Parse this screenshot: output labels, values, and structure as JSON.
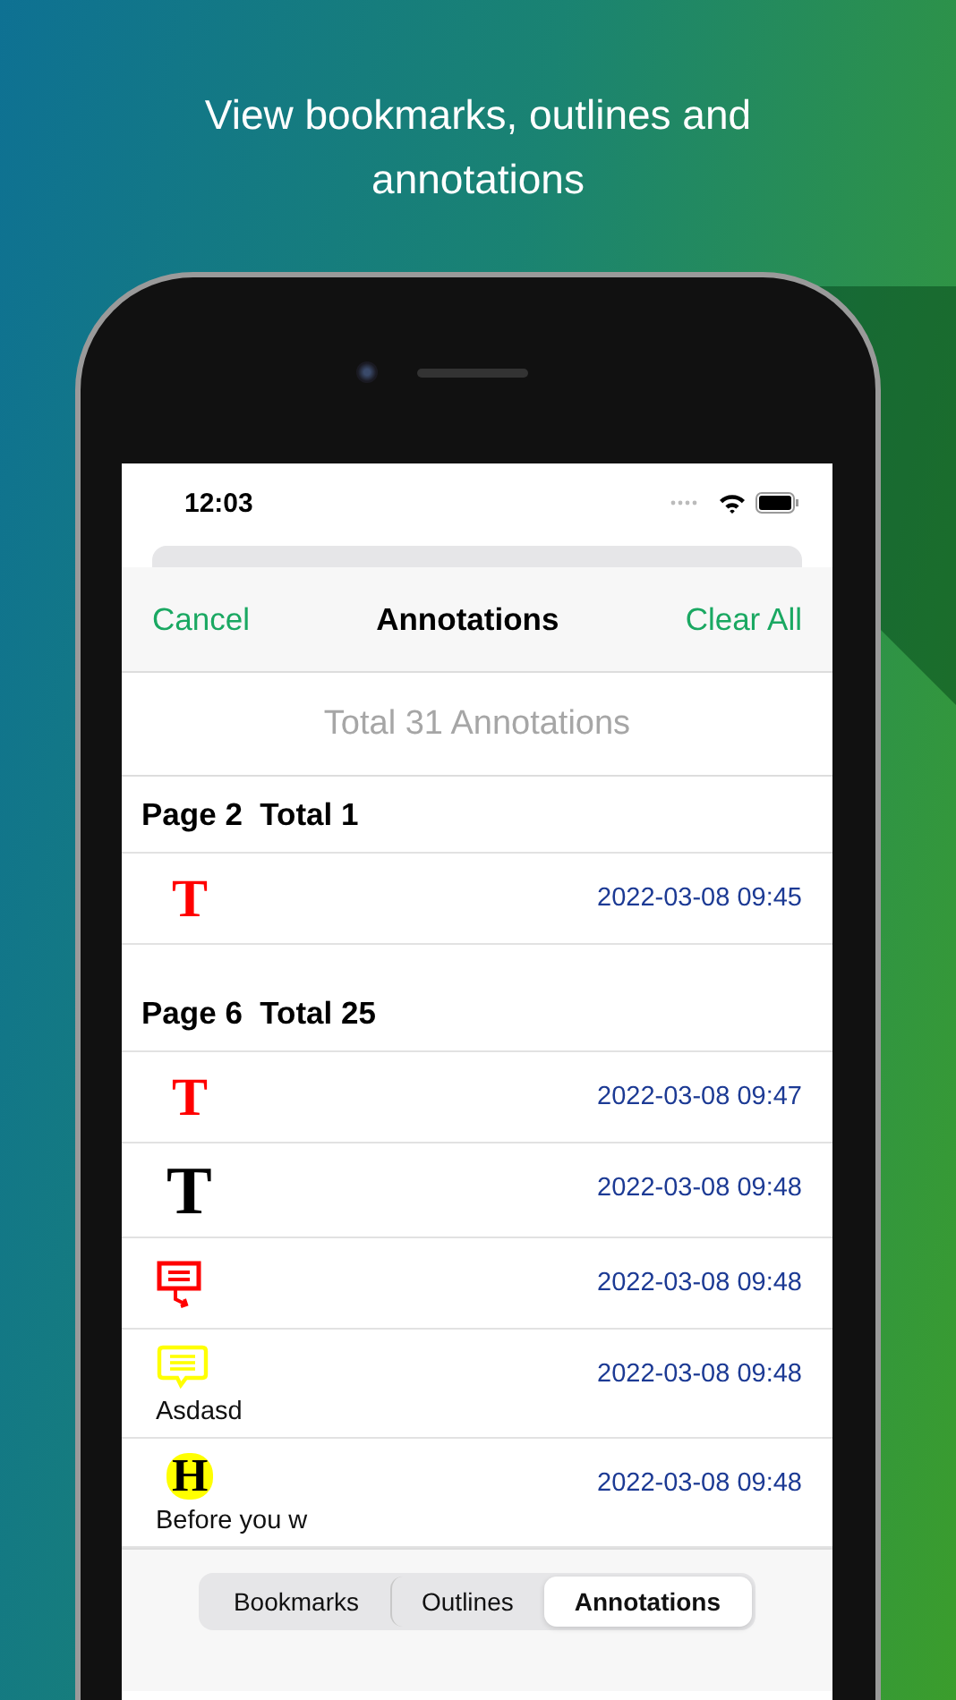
{
  "header": {
    "title": "View bookmarks, outlines and annotations"
  },
  "status_bar": {
    "time": "12:03"
  },
  "nav": {
    "cancel": "Cancel",
    "title": "Annotations",
    "clear": "Clear All"
  },
  "summary": "Total 31 Annotations",
  "sections": [
    {
      "title": "Page 2  Total 1",
      "items": [
        {
          "kind": "text",
          "glyph": "T",
          "color": "#ff0000",
          "time": "2022-03-08 09:45"
        }
      ]
    },
    {
      "title": "Page 6  Total 25",
      "items": [
        {
          "kind": "text",
          "glyph": "T",
          "color": "#ff0000",
          "time": "2022-03-08 09:47"
        },
        {
          "kind": "freetext",
          "glyph": "T",
          "color": "#000000",
          "time": "2022-03-08 09:48"
        },
        {
          "kind": "callout",
          "color": "#ff0000",
          "time": "2022-03-08 09:48"
        },
        {
          "kind": "comment",
          "color": "#ffff00",
          "time": "2022-03-08 09:48",
          "note": "Asdasd"
        },
        {
          "kind": "highlight",
          "glyph": "H",
          "color": "#ffff00",
          "time": "2022-03-08 09:48",
          "note": "Before you w"
        }
      ]
    }
  ],
  "tabs": [
    {
      "label": "Bookmarks",
      "selected": false
    },
    {
      "label": "Outlines",
      "selected": false
    },
    {
      "label": "Annotations",
      "selected": true
    }
  ]
}
